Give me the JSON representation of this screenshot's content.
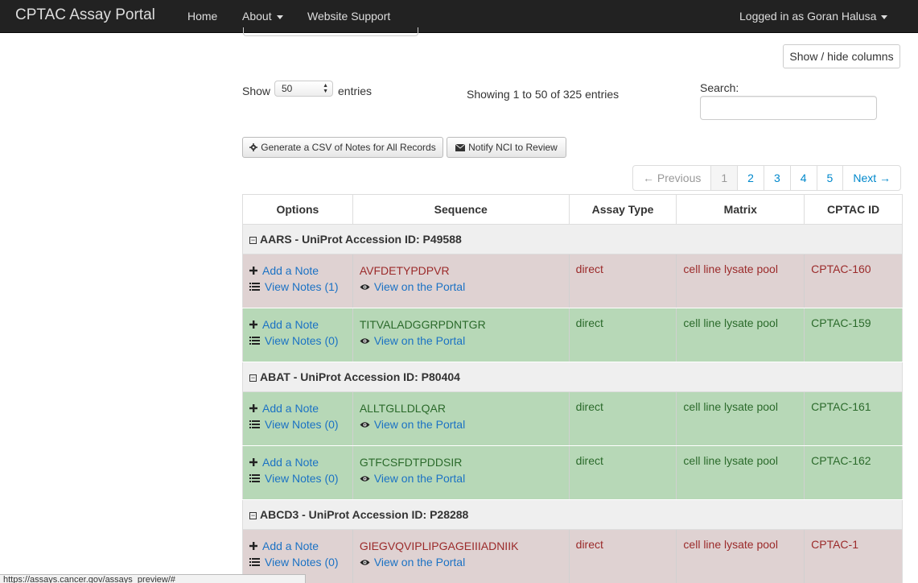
{
  "navbar": {
    "brand": "CPTAC Assay Portal",
    "items": [
      "Home",
      "About",
      "Website Support"
    ],
    "user": "Logged in as Goran Halusa"
  },
  "toolbar": {
    "show_hide_columns": "Show / hide columns",
    "show_label": "Show",
    "page_length": "50",
    "entries_label": "entries",
    "info": "Showing 1 to 50 of 325 entries",
    "search_label": "Search:",
    "search_value": "",
    "csv_button": "Generate a CSV of Notes for All Records",
    "notify_button": "Notify NCI to Review"
  },
  "pagination": {
    "previous": "← Previous",
    "pages": [
      "1",
      "2",
      "3",
      "4",
      "5"
    ],
    "active_page": "1",
    "next": "Next →"
  },
  "table": {
    "columns": [
      "Options",
      "Sequence",
      "Assay Type",
      "Matrix",
      "CPTAC ID"
    ],
    "groups": [
      {
        "label": "AARS - UniProt Accession ID: P49588",
        "rows": [
          {
            "status": "red",
            "add_note": "Add a Note",
            "view_notes": "View Notes (1)",
            "sequence": "AVFDETYPDPVR",
            "view_portal": "View on the Portal",
            "assay_type": "direct",
            "matrix": "cell line lysate pool",
            "cptac_id": "CPTAC-160"
          },
          {
            "status": "green",
            "add_note": "Add a Note",
            "view_notes": "View Notes (0)",
            "sequence": "TITVALADGGRPDNTGR",
            "view_portal": "View on the Portal",
            "assay_type": "direct",
            "matrix": "cell line lysate pool",
            "cptac_id": "CPTAC-159"
          }
        ]
      },
      {
        "label": "ABAT - UniProt Accession ID: P80404",
        "rows": [
          {
            "status": "green",
            "add_note": "Add a Note",
            "view_notes": "View Notes (0)",
            "sequence": "ALLTGLLDLQAR",
            "view_portal": "View on the Portal",
            "assay_type": "direct",
            "matrix": "cell line lysate pool",
            "cptac_id": "CPTAC-161"
          },
          {
            "status": "green",
            "add_note": "Add a Note",
            "view_notes": "View Notes (0)",
            "sequence": "GTFCSFDTPDDSIR",
            "view_portal": "View on the Portal",
            "assay_type": "direct",
            "matrix": "cell line lysate pool",
            "cptac_id": "CPTAC-162"
          }
        ]
      },
      {
        "label": "ABCD3 - UniProt Accession ID: P28288",
        "rows": [
          {
            "status": "red",
            "add_note": "Add a Note",
            "view_notes": "View Notes (0)",
            "sequence": "GIEGVQVIPLIPGAGEIIIADNIIK",
            "view_portal": "View on the Portal",
            "assay_type": "direct",
            "matrix": "cell line lysate pool",
            "cptac_id": "CPTAC-1"
          }
        ]
      }
    ]
  },
  "statusbar": {
    "url": "https://assays.cancer.gov/assays_preview/#"
  },
  "colors": {
    "row_red": "#dfd2d2",
    "row_green": "#b7d8b7",
    "link": "#1b72c4",
    "navbar": "#222222"
  }
}
